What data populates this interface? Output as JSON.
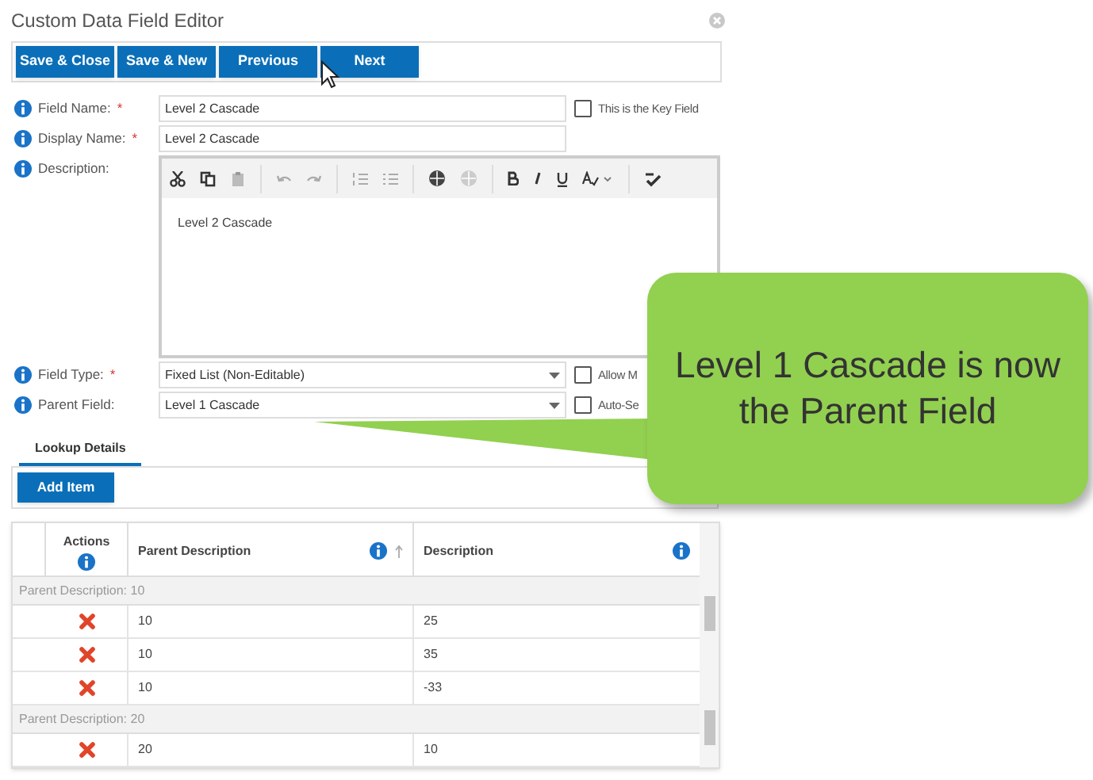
{
  "window": {
    "title": "Custom Data Field Editor"
  },
  "toolbar_buttons": [
    "Save & Close",
    "Save & New",
    "Previous",
    "Next"
  ],
  "fields": [
    {
      "kind": "text",
      "label": "Field Name:",
      "required_mark": "*",
      "value": "Level 2 Cascade",
      "checkbox": {
        "label": "This is the Key Field",
        "checked": false
      }
    },
    {
      "kind": "text",
      "label": "Display Name:",
      "required_mark": "*",
      "value": "Level 2 Cascade"
    },
    {
      "kind": "editor",
      "label": "Description:",
      "value": "Level 2 Cascade"
    },
    {
      "kind": "select",
      "label": "Field Type:",
      "required_mark": "*",
      "value": "Fixed List (Non-Editable)",
      "checkbox": {
        "label": "Allow M",
        "checked": false
      }
    },
    {
      "kind": "select",
      "label": "Parent Field:",
      "value": "Level 1 Cascade",
      "checkbox": {
        "label": "Auto-Se",
        "checked": false
      }
    }
  ],
  "tabs": [
    {
      "label": "Lookup Details",
      "selected": true
    }
  ],
  "add_button": "Add Item",
  "table": {
    "columns": [
      "Actions",
      "Parent Description",
      "Description"
    ],
    "groups": [
      {
        "label": "Parent Description: 10",
        "rows": [
          [
            "10",
            "25"
          ],
          [
            "10",
            "35"
          ],
          [
            "10",
            "-33"
          ]
        ]
      },
      {
        "label": "Parent Description: 20",
        "rows": [
          [
            "20",
            "10"
          ]
        ]
      }
    ]
  },
  "callout": {
    "text": "Level 1 Cascade is now the Parent Field"
  }
}
